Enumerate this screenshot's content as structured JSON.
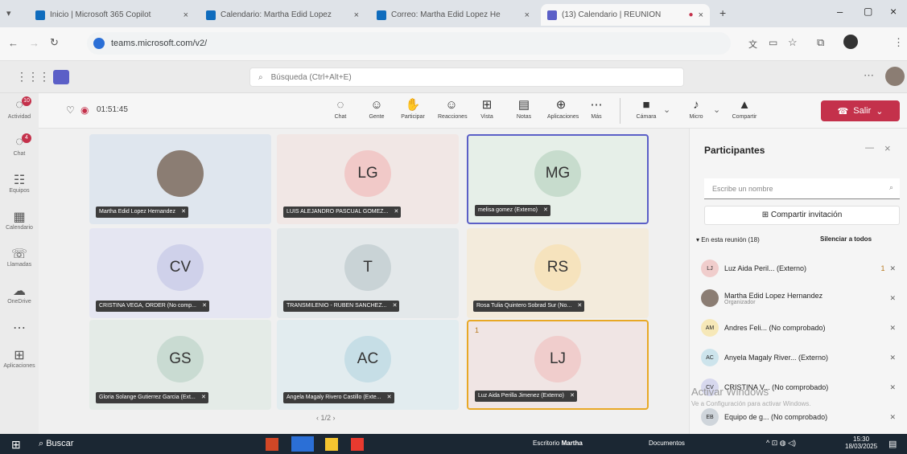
{
  "browser": {
    "tabs": [
      {
        "label": "Inicio | Microsoft 365 Copilot",
        "color": "#0f6cbd"
      },
      {
        "label": "Calendario: Martha Edid Lopez",
        "color": "#0f6cbd"
      },
      {
        "label": "Correo: Martha Edid Lopez He",
        "color": "#0f6cbd"
      },
      {
        "label": "(13) Calendario | REUNION",
        "color": "#5b5fc7"
      }
    ],
    "new_tab": "+",
    "url": "teams.microsoft.com/v2/"
  },
  "teams": {
    "search_placeholder": "Búsqueda (Ctrl+Alt+E)"
  },
  "rail": [
    {
      "label": "Actividad",
      "glyph": "◌",
      "badge": "10"
    },
    {
      "label": "Chat",
      "glyph": "◌",
      "badge": "4"
    },
    {
      "label": "Equipos",
      "glyph": "☷",
      "badge": ""
    },
    {
      "label": "Calendario",
      "glyph": "▦",
      "badge": ""
    },
    {
      "label": "Llamadas",
      "glyph": "☏",
      "badge": ""
    },
    {
      "label": "OneDrive",
      "glyph": "☁",
      "badge": ""
    },
    {
      "label": "",
      "glyph": "⋯",
      "badge": ""
    },
    {
      "label": "Aplicaciones",
      "glyph": "⊞",
      "badge": ""
    }
  ],
  "meeting": {
    "timer": "01:51:45",
    "toolbar": [
      {
        "label": "Chat",
        "glyph": "◌"
      },
      {
        "label": "Gente",
        "glyph": "☺"
      },
      {
        "label": "Participar",
        "glyph": "✋"
      },
      {
        "label": "Reacciones",
        "glyph": "☺"
      },
      {
        "label": "Vista",
        "glyph": "⊞"
      },
      {
        "label": "Notas",
        "glyph": "▤"
      },
      {
        "label": "Aplicaciones",
        "glyph": "⊕"
      },
      {
        "label": "Más",
        "glyph": "⋯"
      }
    ],
    "devices": [
      {
        "label": "Cámara",
        "glyph": "■"
      },
      {
        "label": "Micro",
        "glyph": "♪"
      },
      {
        "label": "Compartir",
        "glyph": "▲"
      }
    ],
    "leave_label": "Salir",
    "pager": "1/2"
  },
  "tiles": [
    {
      "initials": "",
      "name": "Martha Edid Lopez Hernandez",
      "bg": "#dfe6ee",
      "av": "#8b7d73",
      "photo": true,
      "border": ""
    },
    {
      "initials": "LG",
      "name": "LUIS ALEJANDRO PASCUAL GOMEZ...",
      "bg": "#f1e7e5",
      "av": "#f1c9c8",
      "photo": false,
      "border": ""
    },
    {
      "initials": "MG",
      "name": "melisa gomez (Externo)",
      "bg": "#e6efe8",
      "av": "#c7dccd",
      "photo": false,
      "border": "#5b5fc7"
    },
    {
      "initials": "CV",
      "name": "CRISTINA VEGA, ORDER (No comp...",
      "bg": "#e5e6f2",
      "av": "#cfd1ea",
      "photo": false,
      "border": ""
    },
    {
      "initials": "T",
      "name": "TRANSMILENIO - RUBEN SANCHEZ...",
      "bg": "#e3e8ea",
      "av": "#c9d3d6",
      "photo": false,
      "border": ""
    },
    {
      "initials": "RS",
      "name": "Rosa Tulia Quintero Sobrad Sur (No...",
      "bg": "#f3ebdc",
      "av": "#f6e3bd",
      "photo": false,
      "border": ""
    },
    {
      "initials": "GS",
      "name": "Gloria Solange Gutierrez Garcia (Ext...",
      "bg": "#e4ebe7",
      "av": "#c9dbd2",
      "photo": false,
      "border": ""
    },
    {
      "initials": "AC",
      "name": "Angela Magaly Rivero Castillo (Exte...",
      "bg": "#e2ecef",
      "av": "#c6dee6",
      "photo": false,
      "border": ""
    },
    {
      "initials": "LJ",
      "name": "Luz Aida Perilla Jimenez (Externo)",
      "bg": "#f0e5e4",
      "av": "#f0cdcc",
      "photo": false,
      "border": "#e8a825",
      "hand": "1"
    }
  ],
  "participants": {
    "title": "Participantes",
    "find_placeholder": "Escribe un nombre",
    "share_label": "Compartir invitación",
    "section": "En esta reunión (18)",
    "mute_all": "Silenciar a todos",
    "list": [
      {
        "initials": "LJ",
        "name": "Luz Aida Peril... (Externo)",
        "role": "",
        "tag": "1",
        "av": "#f0cdcc"
      },
      {
        "initials": "",
        "name": "Martha Edid Lopez Hernandez",
        "role": "Organizador",
        "tag": "",
        "av": "#8b7d73"
      },
      {
        "initials": "AM",
        "name": "Andres Feli... (No comprobado)",
        "role": "",
        "tag": "",
        "av": "#f6e8b8"
      },
      {
        "initials": "AC",
        "name": "Anyela Magaly River... (Externo)",
        "role": "",
        "tag": "",
        "av": "#cde4ec"
      },
      {
        "initials": "CV",
        "name": "CRISTINA V... (No comprobado)",
        "role": "",
        "tag": "",
        "av": "#d7d8ee"
      },
      {
        "initials": "EB",
        "name": "Equipo de g... (No comprobado)",
        "role": "",
        "tag": "",
        "av": "#cfd5db"
      }
    ],
    "watermark_1": "Activar Windows",
    "watermark_2": "Ve a Configuración para activar Windows."
  },
  "taskbar": {
    "search": "Buscar",
    "items": [
      {
        "label": "Escritorio",
        "sub": "Martha"
      },
      {
        "label": "Documentos",
        "sub": ""
      }
    ],
    "time": "15:30",
    "date": "18/03/2025"
  }
}
